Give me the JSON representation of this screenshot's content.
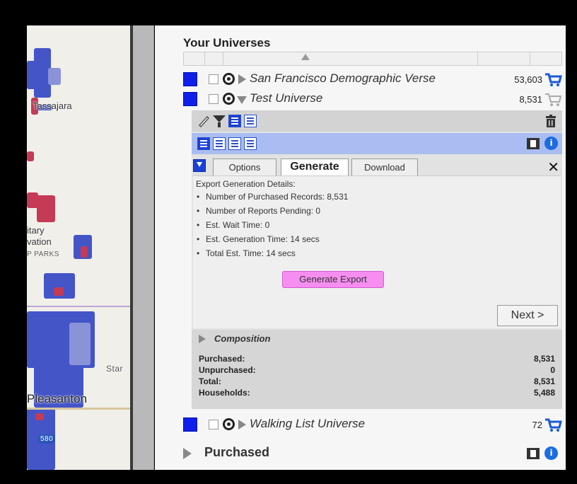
{
  "map": {
    "labels": [
      "Tassajara",
      "itary",
      "vation",
      "P PARKS",
      "Star",
      "Pleasanton",
      "580"
    ]
  },
  "panel": {
    "heading": "Your Universes",
    "universes": [
      {
        "name": "San Francisco Demographic Verse",
        "count": "53,603",
        "expanded": false,
        "cart": "active"
      },
      {
        "name": "Test Universe",
        "count": "8,531",
        "expanded": true,
        "cart": "inactive"
      },
      {
        "name": "Walking List Universe",
        "count": "72",
        "expanded": false,
        "cart": "active"
      }
    ],
    "tabs": {
      "options": "Options",
      "generate": "Generate",
      "download": "Download"
    },
    "close_label": "✕",
    "export": {
      "title": "Export Generation Details:",
      "items": [
        "Number of Purchased Records: 8,531",
        "Number of Reports Pending: 0",
        "Est. Wait Time: 0",
        "Est. Generation Time: 14 secs",
        "Total Est. Time: 14 secs"
      ],
      "generate_button": "Generate Export",
      "next_button": "Next >"
    },
    "composition": {
      "title": "Composition",
      "rows": [
        {
          "label": "Purchased:",
          "value": "8,531"
        },
        {
          "label": "Unpurchased:",
          "value": "0"
        },
        {
          "label": "Total:",
          "value": "8,531"
        },
        {
          "label": "Households:",
          "value": "5,488"
        }
      ]
    },
    "purchased_label": "Purchased",
    "info_icon_glyph": "i"
  },
  "colors": {
    "universe_swatch": "#1020e8",
    "toolbar_highlight": "#a9bdf2",
    "generate_button": "#f58ef0"
  }
}
